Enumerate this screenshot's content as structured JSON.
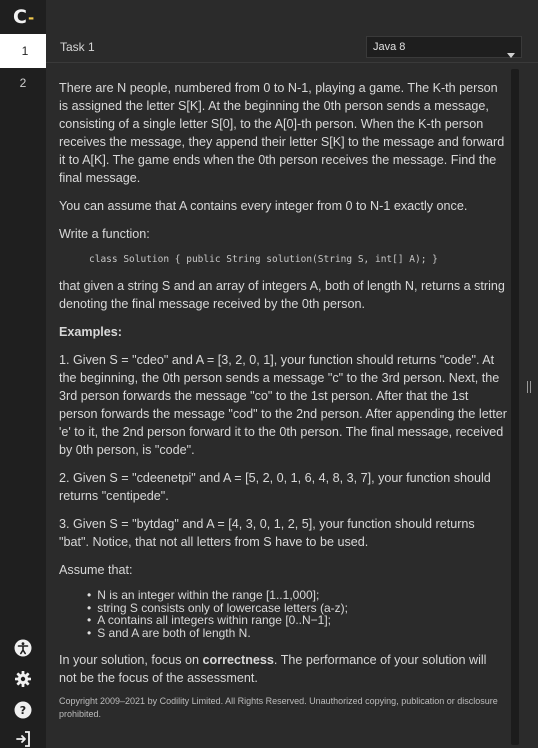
{
  "app": {
    "logo": "C",
    "logo_dash": "-"
  },
  "tasks": [
    {
      "label": "1"
    },
    {
      "label": "2"
    }
  ],
  "header": {
    "task_title": "Task 1",
    "language": "Java 8"
  },
  "rail_icons": [
    "accessibility-icon",
    "gear-icon",
    "help-icon",
    "exit-icon"
  ],
  "task": {
    "intro": "There are N people, numbered from 0 to N-1, playing a game. The K-th person is assigned the letter S[K]. At the beginning the 0th person sends a message, consisting of a single letter S[0], to the A[0]-th person. When the K-th person receives the message, they append their letter S[K] to the message and forward it to A[K]. The game ends when the 0th person receives the message. Find the final message.",
    "assume_line": "You can assume that A contains every integer from 0 to N-1 exactly once.",
    "write_fn": "Write a function:",
    "signature": "class Solution { public String solution(String S, int[] A); }",
    "returns": "that given a string S and an array of integers A, both of length N, returns a string denoting the final message received by the 0th person.",
    "examples_label": "Examples:",
    "example1": "1. Given S = \"cdeo\" and A = [3, 2, 0, 1], your function should returns \"code\". At the beginning, the 0th person sends a message \"c\" to the 3rd person. Next, the 3rd person forwards the message \"co\" to the 1st person. After that the 1st person forwards the message \"cod\" to the 2nd person. After appending the letter 'e' to it, the 2nd person forward it to the 0th person. The final message, received by 0th person, is \"code\".",
    "example2": "2. Given S = \"cdeenetpi\" and A = [5, 2, 0, 1, 6, 4, 8, 3, 7], your function should returns \"centipede\".",
    "example3": "3. Given S = \"bytdag\" and A = [4, 3, 0, 1, 2, 5], your function should returns \"bat\". Notice, that not all letters from S have to be used.",
    "assume_label": "Assume that:",
    "constraints": [
      "N is an integer within the range [1..1,000];",
      "string S consists only of lowercase letters (a-z);",
      "A contains all integers within range [0..N−1];",
      "S and A are both of length N."
    ],
    "focus_pre": "In your solution, focus on ",
    "focus_bold": "correctness",
    "focus_post": ". The performance of your solution will not be the focus of the assessment.",
    "copyright": "Copyright 2009–2021 by Codility Limited. All Rights Reserved. Unauthorized copying, publication or disclosure prohibited."
  }
}
